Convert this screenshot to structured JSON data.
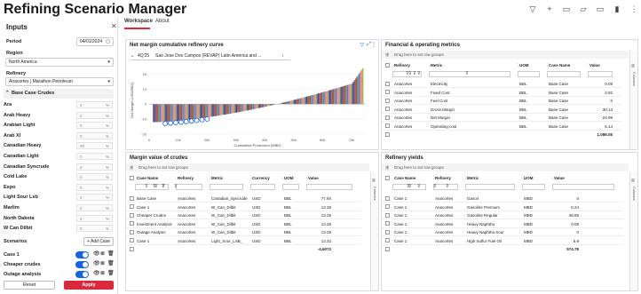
{
  "app": {
    "title": "Refining Scenario Manager",
    "toolbar_icons": [
      "filter-icon",
      "add-icon",
      "folder-icon",
      "folder-open-icon",
      "monitor-icon",
      "bookmark-icon",
      "more-vertical-icon"
    ]
  },
  "sidebar": {
    "title": "Inputs",
    "period_label": "Period",
    "period_value": "04/01/2024",
    "region_label": "Region",
    "region_value": "North America",
    "refinery_label": "Refinery",
    "refinery_value": "Anacortes | Marathon Petroleum",
    "base_crudes_label": "Base Case Crudes",
    "crudes": [
      "Ara",
      "Arab Heavy",
      "Arabian Light",
      "Arab XI",
      "Canadian Heavy",
      "Canadian Light",
      "Canadian Syncrude",
      "Cold Lake",
      "Espo",
      "Light Sour Lsb",
      "Marlim",
      "North Dakota",
      "W Can Dilbit"
    ],
    "crude_values": [
      "0",
      "0",
      "0",
      "0",
      "30",
      "0",
      "0",
      "0",
      "0",
      "0",
      "0",
      "0",
      "0"
    ],
    "pct_symbol": "%",
    "scenarios_label": "Scenarios",
    "add_case_label": "+ Add Case",
    "scenarios": [
      "Case 1",
      "Cheaper crudes",
      "Outage analysis"
    ],
    "reset_label": "Reset",
    "apply_label": "Apply"
  },
  "tabs": [
    "Workspace",
    "About"
  ],
  "chart_panel": {
    "title": "Net margin cumulative refinery curve",
    "select_prefix": "4Q'25",
    "select_value": "Sao Jose Dos Campos (REVAP) Latin America and ...",
    "chart_data": {
      "type": "bar",
      "xlabel": "Cumulative Production (MBD)",
      "ylabel": "Net Margin (USD/BBL)",
      "xlim": [
        0,
        80000
      ],
      "ylim": [
        -20,
        25
      ],
      "x_ticks": [
        "0",
        "10k",
        "20k",
        "30k",
        "40k",
        "50k",
        "60k",
        "70k"
      ],
      "y_ticks": [
        "20",
        "10",
        "0",
        "-10",
        "-20"
      ]
    }
  },
  "fin_panel": {
    "title": "Financial & operating metrics",
    "group_hint": "Drag here to set row groups",
    "headers": [
      "Refinery",
      "Metric",
      "UOM",
      "Case Name",
      "Value"
    ],
    "rows": [
      [
        "Anacortes",
        "Electricity",
        "BBL",
        "Base Case",
        "0.09"
      ],
      [
        "Anacortes",
        "Fixed Cost",
        "BBL",
        "Base Case",
        "4.92"
      ],
      [
        "Anacortes",
        "Fuel Cost",
        "BBL",
        "Base Case",
        "0"
      ],
      [
        "Anacortes",
        "Gross Margin",
        "BBL",
        "Base Case",
        "30.13"
      ],
      [
        "Anacortes",
        "Net Margin",
        "BBL",
        "Base Case",
        "24.99"
      ],
      [
        "Anacortes",
        "Operating cost",
        "BBL",
        "Base Case",
        "6.14"
      ]
    ],
    "total": "1,086.05",
    "columns_label": "Columns"
  },
  "crude_panel": {
    "title": "Margin value of crudes",
    "group_hint": "Drag here to set row groups",
    "headers": [
      "Case Name",
      "Refinery",
      "Metric",
      "Currency",
      "UOM",
      "Value"
    ],
    "rows": [
      [
        "Base Case",
        "Anacortes",
        "Canadian_Syncrude",
        "USD",
        "BBL",
        "77.94"
      ],
      [
        "Case 1",
        "Anacortes",
        "W_Can_Dilbit",
        "USD",
        "BBL",
        "13.28"
      ],
      [
        "Cheaper Crudes",
        "Anacortes",
        "W_Can_Dilbit",
        "USD",
        "BBL",
        "13.28"
      ],
      [
        "Investment Analysis",
        "Anacortes",
        "W_Can_Dilbit",
        "USD",
        "BBL",
        "13.28"
      ],
      [
        "Outage Analysis",
        "Anacortes",
        "W_Can_Dilbit",
        "USD",
        "BBL",
        "13.28"
      ],
      [
        "Case 1",
        "Anacortes",
        "Light_Sour_LSB_",
        "USD",
        "BBL",
        "13.32"
      ]
    ],
    "total": "-4,6072",
    "columns_label": "Columns"
  },
  "yield_panel": {
    "title": "Refinery yields",
    "group_hint": "Drag here to set row groups",
    "headers": [
      "Case Name",
      "Refinery",
      "Metric",
      "UOM",
      "Value"
    ],
    "rows": [
      [
        "Case 1",
        "Anacortes",
        "Gasoil",
        "MBD",
        "0"
      ],
      [
        "Case 1",
        "Anacortes",
        "Gasoline Premium",
        "MBD",
        "0.24"
      ],
      [
        "Case 1",
        "Anacortes",
        "Gasoline Regular",
        "MBD",
        "48.85"
      ],
      [
        "Case 1",
        "Anacortes",
        "Heavy Naphtha",
        "MBD",
        "0.08"
      ],
      [
        "Case 1",
        "Anacortes",
        "Heavy Naphtha Sour",
        "MBD",
        "0"
      ],
      [
        "Case 1",
        "Anacortes",
        "High Sulfur Fuel Oil",
        "MBD",
        "6.9"
      ]
    ],
    "total": "574.78",
    "columns_label": "Columns"
  }
}
